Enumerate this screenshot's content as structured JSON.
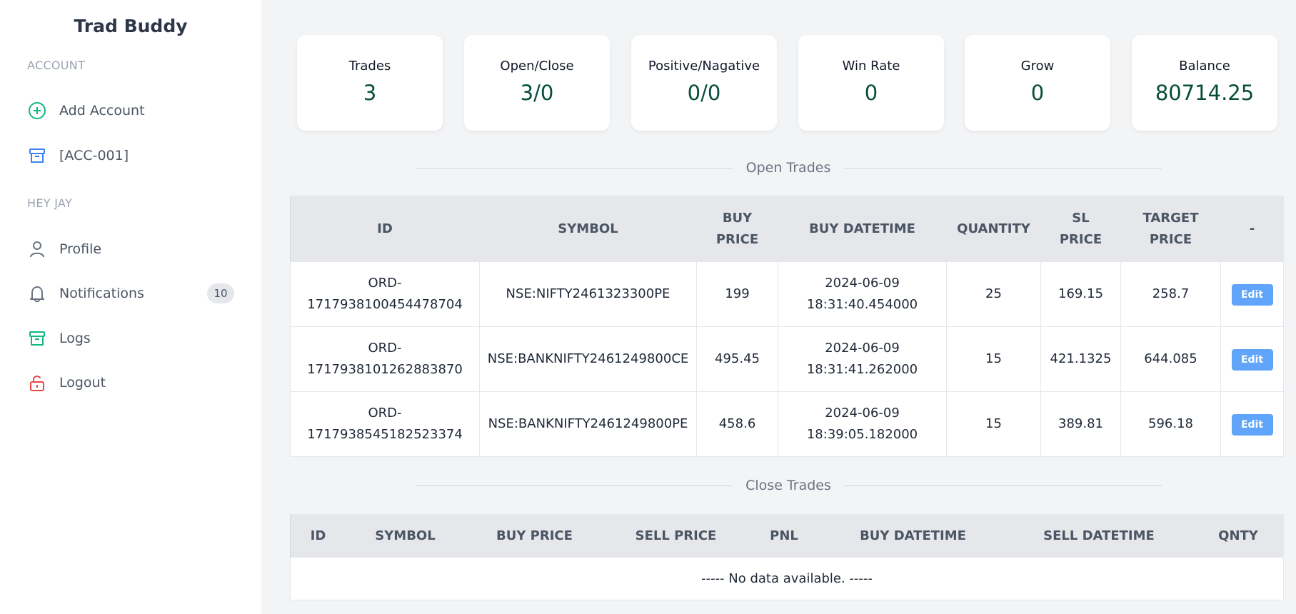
{
  "app": {
    "title": "Trad Buddy"
  },
  "sidebar": {
    "account_label": "ACCOUNT",
    "add_account": "Add Account",
    "account_item": "[ACC-001]",
    "greeting_label": "HEY JAY",
    "profile": "Profile",
    "notifications": "Notifications",
    "notifications_count": "10",
    "logs": "Logs",
    "logout": "Logout"
  },
  "stats": [
    {
      "title": "Trades",
      "value": "3"
    },
    {
      "title": "Open/Close",
      "value": "3/0"
    },
    {
      "title": "Positive/Nagative",
      "value": "0/0"
    },
    {
      "title": "Win Rate",
      "value": "0"
    },
    {
      "title": "Grow",
      "value": "0"
    },
    {
      "title": "Balance",
      "value": "80714.25"
    }
  ],
  "open_trades": {
    "heading": "Open Trades",
    "headers": {
      "id": "ID",
      "symbol": "SYMBOL",
      "buy_price_1": "BUY",
      "buy_price_2": "PRICE",
      "buy_datetime": "BUY DATETIME",
      "quantity": "QUANTITY",
      "sl_price_1": "SL",
      "sl_price_2": "PRICE",
      "target_price_1": "TARGET",
      "target_price_2": "PRICE",
      "action": "-"
    },
    "rows": [
      {
        "id_1": "ORD-",
        "id_2": "1717938100454478704",
        "symbol": "NSE:NIFTY2461323300PE",
        "buy_price": "199",
        "date": "2024-06-09",
        "time": "18:31:40.454000",
        "quantity": "25",
        "sl_price": "169.15",
        "target_price": "258.7",
        "action": "Edit"
      },
      {
        "id_1": "ORD-",
        "id_2": "1717938101262883870",
        "symbol": "NSE:BANKNIFTY2461249800CE",
        "buy_price": "495.45",
        "date": "2024-06-09",
        "time": "18:31:41.262000",
        "quantity": "15",
        "sl_price": "421.1325",
        "target_price": "644.085",
        "action": "Edit"
      },
      {
        "id_1": "ORD-",
        "id_2": "1717938545182523374",
        "symbol": "NSE:BANKNIFTY2461249800PE",
        "buy_price": "458.6",
        "date": "2024-06-09",
        "time": "18:39:05.182000",
        "quantity": "15",
        "sl_price": "389.81",
        "target_price": "596.18",
        "action": "Edit"
      }
    ]
  },
  "close_trades": {
    "heading": "Close Trades",
    "headers": {
      "id": "ID",
      "symbol": "SYMBOL",
      "buy_price": "BUY PRICE",
      "sell_price": "SELL PRICE",
      "pnl": "PNL",
      "buy_datetime": "BUY DATETIME",
      "sell_datetime": "SELL DATETIME",
      "qnty": "QNTY"
    },
    "empty_message": "----- No data available. -----"
  },
  "colors": {
    "accent_green": "#10b981",
    "accent_blue": "#60a5fa",
    "logout_red": "#ef4444",
    "stat_value": "#064e3b"
  }
}
